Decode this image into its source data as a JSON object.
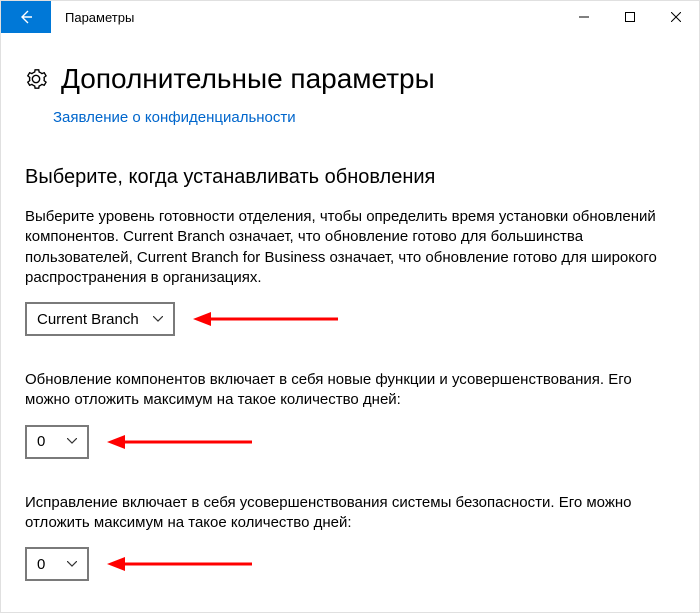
{
  "titlebar": {
    "app_name": "Параметры"
  },
  "header": {
    "page_title": "Дополнительные параметры",
    "privacy_link": "Заявление о конфиденциальности"
  },
  "section": {
    "heading": "Выберите, когда устанавливать обновления",
    "para1": "Выберите уровень готовности отделения, чтобы определить время установки обновлений компонентов. Current Branch означает, что обновление готово для большинства пользователей, Current Branch for Business означает, что обновление готово для широкого распространения в организациях.",
    "select_branch": "Current Branch",
    "para2": "Обновление компонентов включает в себя новые функции и усовершенствования. Его можно отложить максимум на такое количество дней:",
    "select_feature_days": "0",
    "para3": "Исправление включает в себя усовершенствования системы безопасности. Его можно отложить максимум на такое количество дней:",
    "select_quality_days": "0"
  },
  "colors": {
    "accent": "#0078d7",
    "arrow": "#ff0000"
  }
}
